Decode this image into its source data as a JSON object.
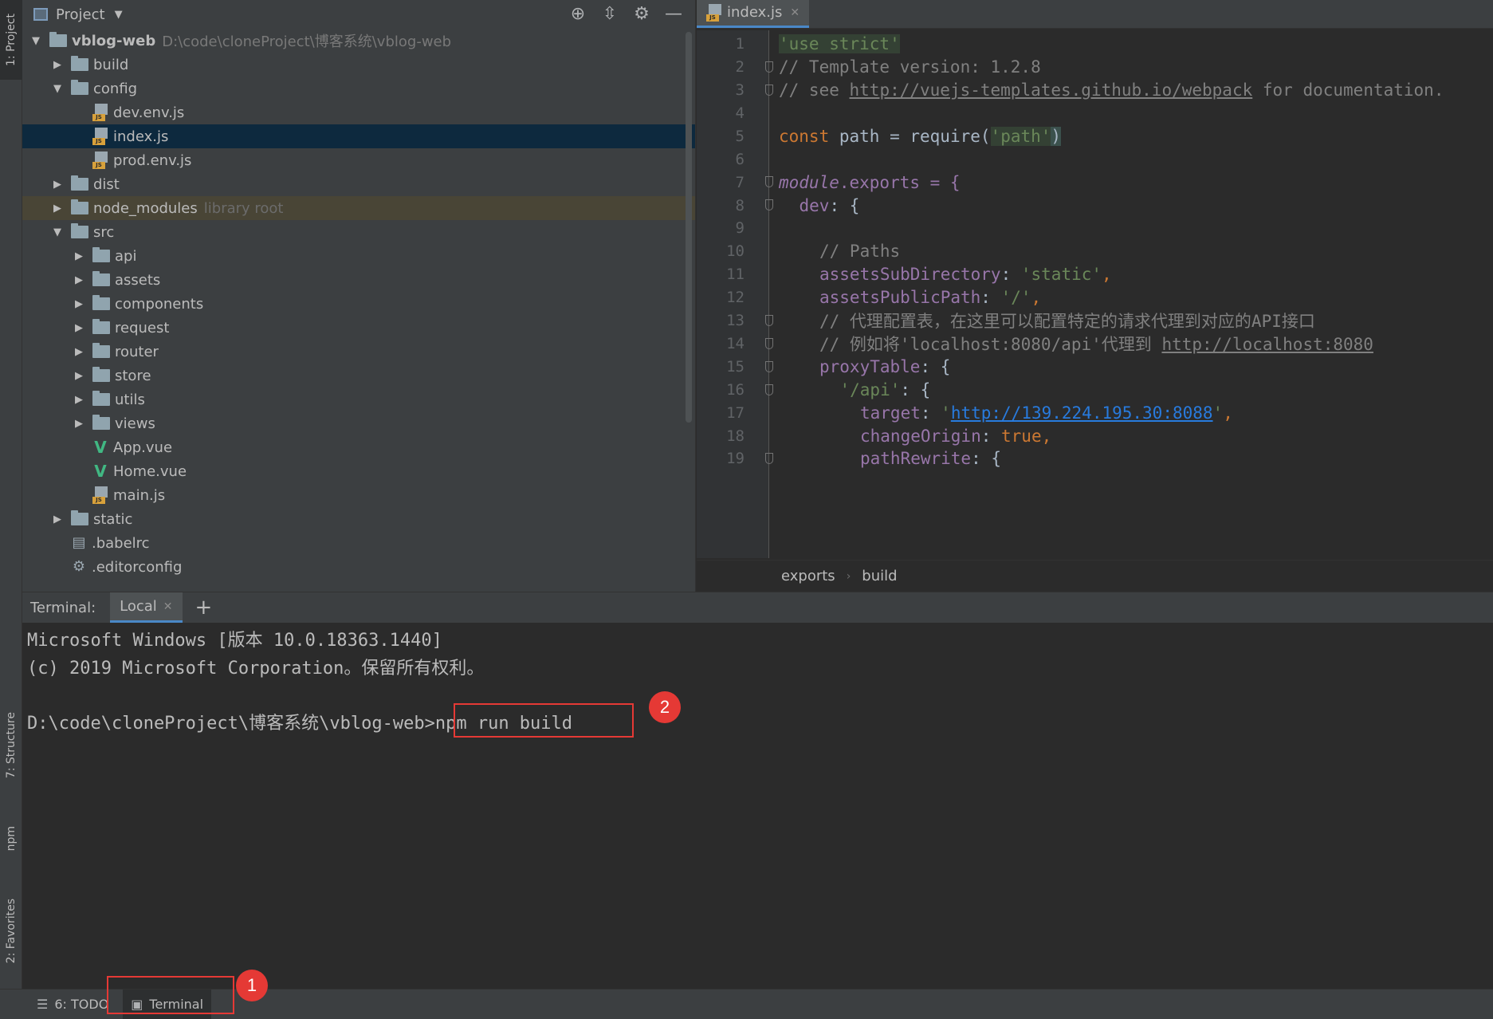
{
  "left_strip": {
    "project_tab": "1: Project",
    "structure_tab": "7: Structure",
    "npm_tab": "npm",
    "favorites_tab": "2: Favorites"
  },
  "project_panel": {
    "title": "Project",
    "tree": [
      {
        "label": "vblog-web",
        "hint": "D:\\code\\cloneProject\\博客系统\\vblog-web",
        "type": "folder",
        "depth": 0,
        "expanded": true
      },
      {
        "label": "build",
        "type": "folder",
        "depth": 1,
        "expanded": false
      },
      {
        "label": "config",
        "type": "folder",
        "depth": 1,
        "expanded": true
      },
      {
        "label": "dev.env.js",
        "type": "js",
        "depth": 2
      },
      {
        "label": "index.js",
        "type": "js",
        "depth": 2,
        "selected": true
      },
      {
        "label": "prod.env.js",
        "type": "js",
        "depth": 2
      },
      {
        "label": "dist",
        "type": "folder",
        "depth": 1,
        "expanded": false
      },
      {
        "label": "node_modules",
        "hint": "library root",
        "type": "folder",
        "depth": 1,
        "expanded": false,
        "library": true
      },
      {
        "label": "src",
        "type": "folder",
        "depth": 1,
        "expanded": true
      },
      {
        "label": "api",
        "type": "folder",
        "depth": 2,
        "expanded": false
      },
      {
        "label": "assets",
        "type": "folder",
        "depth": 2,
        "expanded": false
      },
      {
        "label": "components",
        "type": "folder",
        "depth": 2,
        "expanded": false
      },
      {
        "label": "request",
        "type": "folder",
        "depth": 2,
        "expanded": false
      },
      {
        "label": "router",
        "type": "folder",
        "depth": 2,
        "expanded": false
      },
      {
        "label": "store",
        "type": "folder",
        "depth": 2,
        "expanded": false
      },
      {
        "label": "utils",
        "type": "folder",
        "depth": 2,
        "expanded": false
      },
      {
        "label": "views",
        "type": "folder",
        "depth": 2,
        "expanded": false
      },
      {
        "label": "App.vue",
        "type": "vue",
        "depth": 2
      },
      {
        "label": "Home.vue",
        "type": "vue",
        "depth": 2
      },
      {
        "label": "main.js",
        "type": "js",
        "depth": 2
      },
      {
        "label": "static",
        "type": "folder",
        "depth": 1,
        "expanded": false
      },
      {
        "label": ".babelrc",
        "type": "cfg",
        "depth": 1
      },
      {
        "label": ".editorconfig",
        "type": "gear",
        "depth": 1
      }
    ]
  },
  "editor": {
    "tab_label": "index.js",
    "line_numbers": [
      "1",
      "2",
      "3",
      "4",
      "5",
      "6",
      "7",
      "8",
      "9",
      "10",
      "11",
      "12",
      "13",
      "14",
      "15",
      "16",
      "17",
      "18",
      "19"
    ],
    "code": {
      "l1": "'use strict'",
      "l2": "// Template version: 1.2.8",
      "l3_pre": "// see ",
      "l3_link": "http://vuejs-templates.github.io/webpack",
      "l3_post": " for documentation.",
      "l5_kw": "const",
      "l5_mid": " path = ",
      "l5_fn": "require",
      "l5_open": "(",
      "l5_str": "'path'",
      "l5_close": ")",
      "l7_mod": "module",
      "l7_rest": ".exports = {",
      "l8_key": "dev",
      "l8_rest": ": {",
      "l10": "// Paths",
      "l11_key": "assetsSubDirectory",
      "l11_colon": ": ",
      "l11_val": "'static'",
      "l11_comma": ",",
      "l12_key": "assetsPublicPath",
      "l12_colon": ": ",
      "l12_val": "'/'",
      "l12_comma": ",",
      "l13": "// 代理配置表，在这里可以配置特定的请求代理到对应的API接口",
      "l14_pre": "// 例如将'localhost:8080/api'代理到 ",
      "l14_link": "http://localhost:8080",
      "l15_key": "proxyTable",
      "l15_rest": ": {",
      "l16_key": "'/api'",
      "l16_rest": ": {",
      "l17_key": "target",
      "l17_colon": ": ",
      "l17_q1": "'",
      "l17_link": "http://139.224.195.30:8088",
      "l17_q2": "'",
      "l17_comma": ",",
      "l18_key": "changeOrigin",
      "l18_colon": ": ",
      "l18_val": "true",
      "l18_comma": ",",
      "l19_key": "pathRewrite",
      "l19_rest": ": {"
    },
    "breadcrumbs": [
      "exports",
      "build"
    ]
  },
  "terminal": {
    "label": "Terminal:",
    "tab": "Local",
    "lines": [
      "Microsoft Windows [版本 10.0.18363.1440]",
      "(c) 2019 Microsoft Corporation。保留所有权利。",
      "",
      "D:\\code\\cloneProject\\博客系统\\vblog-web>npm run build"
    ],
    "callout_2": "2"
  },
  "statusbar": {
    "todo": "6: TODO",
    "terminal": "Terminal",
    "callout_1": "1"
  }
}
